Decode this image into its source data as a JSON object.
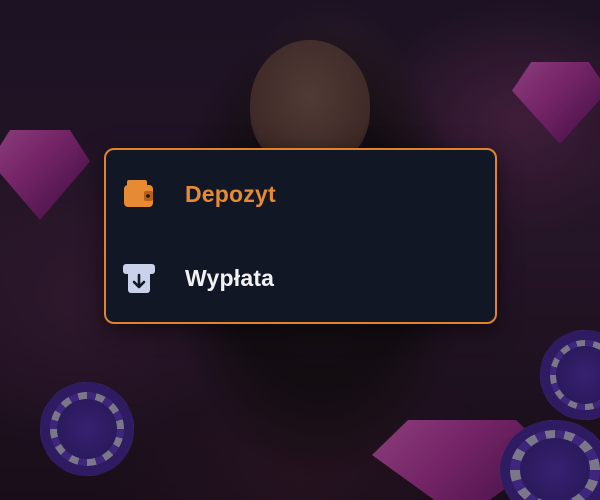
{
  "menu": {
    "items": [
      {
        "label": "Depozyt",
        "icon": "wallet-icon",
        "color": "#e68a34"
      },
      {
        "label": "Wypłata",
        "icon": "withdraw-icon",
        "color": "#f2f2f5"
      }
    ],
    "border_color": "#e0832a",
    "background_color": "#111725"
  }
}
